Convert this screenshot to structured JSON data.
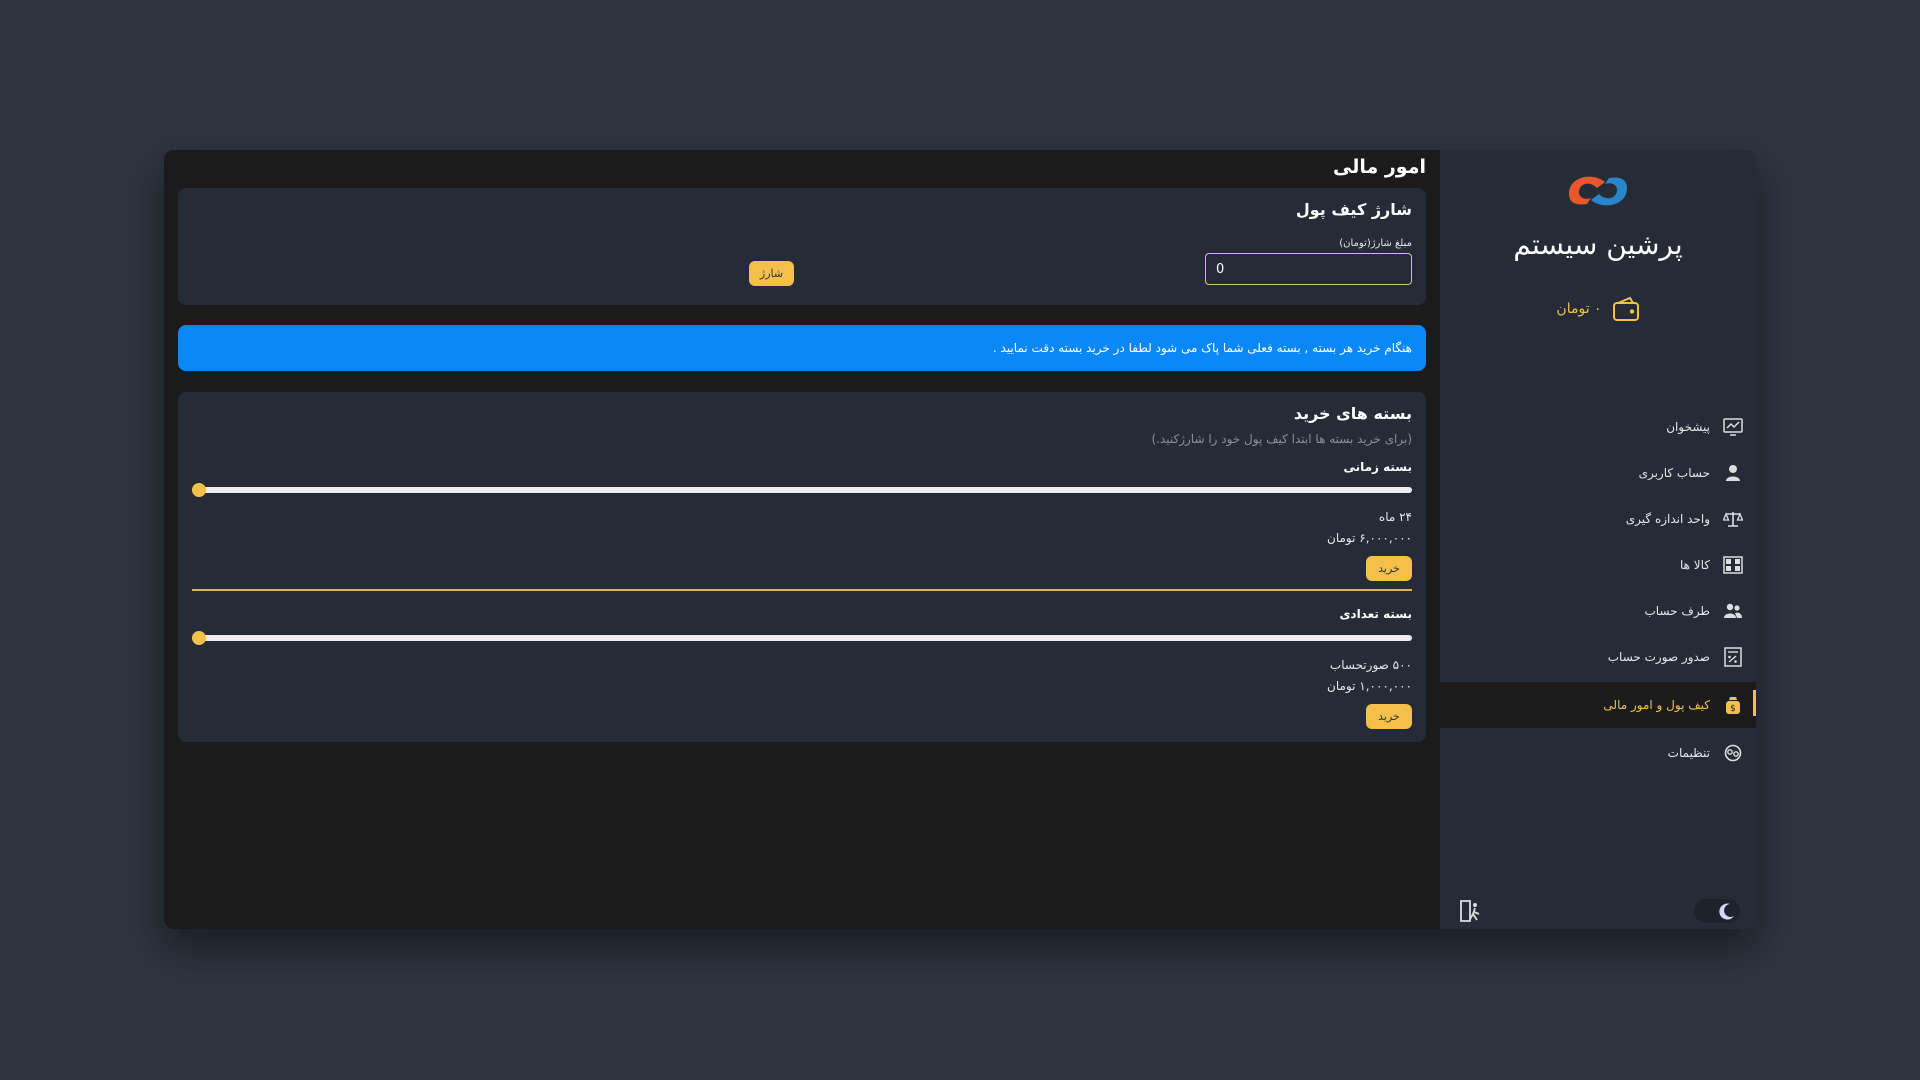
{
  "page": {
    "title": "امور مالی"
  },
  "sidebar": {
    "logo_text": "پرشین سیستم",
    "balance": "۰ تومان",
    "items": [
      {
        "label": "پیشخوان",
        "icon": "dashboard-chart-icon"
      },
      {
        "label": "حساب کاربری",
        "icon": "user-icon"
      },
      {
        "label": "واحد اندازه گیری",
        "icon": "scale-icon"
      },
      {
        "label": "کالا ها",
        "icon": "products-icon"
      },
      {
        "label": "طرف حساب",
        "icon": "contacts-icon"
      },
      {
        "label": "صدور صورت حساب",
        "icon": "invoice-icon"
      },
      {
        "label": "کیف پول و امور مالی",
        "icon": "wallet-icon",
        "active": true
      },
      {
        "label": "تنظیمات",
        "icon": "settings-icon"
      }
    ]
  },
  "charge": {
    "title": "شارژ کیف پول",
    "field_label": "مبلغ شارژ(تومان)",
    "amount_value": "0",
    "button_label": "شارژ"
  },
  "alert": {
    "text": "هنگام خرید هر بسته , بسته فعلی شما پاک می شود لطفا در خرید بسته دقت نمایید ."
  },
  "packages": {
    "title": "بسته های خرید",
    "subtitle": "(برای خرید بسته ها ابتدا کیف پول خود را شارژکنید.)",
    "items": [
      {
        "name": "بسته زمانی",
        "slider_position": 0,
        "line1": "۲۴  ماه",
        "line2": "۶,۰۰۰,۰۰۰  تومان",
        "button_label": "خرید"
      },
      {
        "name": "بسته تعدادی",
        "slider_position": 0,
        "line1": "۵۰۰  صورتحساب",
        "line2": "۱,۰۰۰,۰۰۰  تومان",
        "button_label": "خرید"
      }
    ]
  },
  "colors": {
    "accent": "#f5c04a",
    "alert": "#0b88f7",
    "background": "#2e3440",
    "panel": "#252c38",
    "window": "#1b1b1c"
  }
}
